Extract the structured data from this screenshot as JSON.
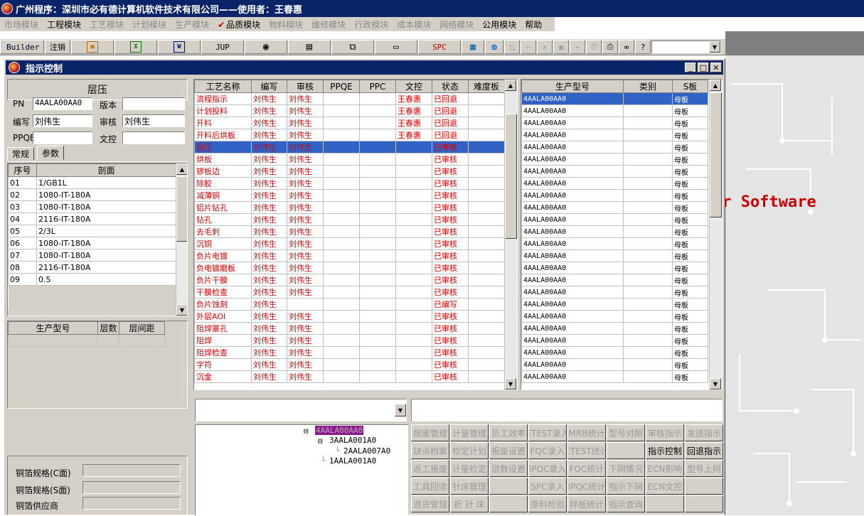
{
  "title": "广州程序：深圳市必有德计算机软件技术有限公司——使用者：王春惠",
  "menus": [
    {
      "label": "市场模块",
      "enabled": false
    },
    {
      "label": "工程模块",
      "enabled": true
    },
    {
      "label": "工艺模块",
      "enabled": false
    },
    {
      "label": "计划模块",
      "enabled": false
    },
    {
      "label": "生产模块",
      "enabled": false
    },
    {
      "label": "品质模块",
      "enabled": true,
      "checked": true
    },
    {
      "label": "物料模块",
      "enabled": false
    },
    {
      "label": "维修模块",
      "enabled": false
    },
    {
      "label": "行政模块",
      "enabled": false
    },
    {
      "label": "成本模块",
      "enabled": false
    },
    {
      "label": "网络模块",
      "enabled": false
    },
    {
      "label": "公用模块",
      "enabled": true
    },
    {
      "label": "帮助",
      "enabled": true
    }
  ],
  "toolbar": {
    "builder": "Builder",
    "logout": "注销",
    "jup": "JUP",
    "spc": "SPC"
  },
  "background_text": "er Software",
  "window": {
    "title": "指示控制"
  },
  "layer": {
    "header": "层压",
    "pn_label": "PN",
    "pn_value": "4AALA00AA0",
    "version_label": "版本",
    "version_value": "",
    "author_label": "编写",
    "author_value": "刘伟生",
    "reviewer_label": "审核",
    "reviewer_value": "刘伟生",
    "ppqe_label": "PPQE",
    "ppqe_value": "",
    "doc_label": "文控",
    "doc_value": "",
    "tabs": [
      "常规",
      "参数"
    ]
  },
  "section_table": {
    "headers": [
      "序号",
      "剖面"
    ],
    "rows": [
      [
        "01",
        "1/GB1L"
      ],
      [
        "02",
        "1080-IT-180A"
      ],
      [
        "03",
        "1080-IT-180A"
      ],
      [
        "04",
        "2116-IT-180A"
      ],
      [
        "05",
        "2/3L"
      ],
      [
        "06",
        "1080-IT-180A"
      ],
      [
        "07",
        "1080-IT-180A"
      ],
      [
        "08",
        "2116-IT-180A"
      ],
      [
        "09",
        "0.5"
      ]
    ]
  },
  "model_table": {
    "headers": [
      "生产型号",
      "层数",
      "层间距"
    ]
  },
  "copper": {
    "c_label": "铜箔规格(C面)",
    "s_label": "铜箔规格(S面)",
    "supplier_label": "铜箔供应商"
  },
  "process_table": {
    "headers": [
      "工艺名称",
      "编写",
      "审核",
      "PPQE",
      "PPC",
      "文控",
      "状态",
      "难度板"
    ],
    "rows": [
      [
        "流程指示",
        "刘伟生",
        "刘伟生",
        "",
        "",
        "王春惠",
        "已回退",
        ""
      ],
      [
        "计划投料",
        "刘伟生",
        "刘伟生",
        "",
        "",
        "王春惠",
        "已回退",
        ""
      ],
      [
        "开料",
        "刘伟生",
        "刘伟生",
        "",
        "",
        "王春惠",
        "已回退",
        ""
      ],
      [
        "开料后烘板",
        "刘伟生",
        "刘伟生",
        "",
        "",
        "王春惠",
        "已回退",
        ""
      ],
      [
        "层压",
        "刘伟生",
        "刘伟生",
        "",
        "",
        "",
        "已审核",
        ""
      ],
      [
        "烘板",
        "刘伟生",
        "刘伟生",
        "",
        "",
        "",
        "已审核",
        ""
      ],
      [
        "锣板边",
        "刘伟生",
        "刘伟生",
        "",
        "",
        "",
        "已审核",
        ""
      ],
      [
        "除胶",
        "刘伟生",
        "刘伟生",
        "",
        "",
        "",
        "已审核",
        ""
      ],
      [
        "减薄铜",
        "刘伟生",
        "刘伟生",
        "",
        "",
        "",
        "已审核",
        ""
      ],
      [
        "铝片钻孔",
        "刘伟生",
        "刘伟生",
        "",
        "",
        "",
        "已审核",
        ""
      ],
      [
        "钻孔",
        "刘伟生",
        "刘伟生",
        "",
        "",
        "",
        "已审核",
        ""
      ],
      [
        "去毛刺",
        "刘伟生",
        "刘伟生",
        "",
        "",
        "",
        "已审核",
        ""
      ],
      [
        "沉铜",
        "刘伟生",
        "刘伟生",
        "",
        "",
        "",
        "已审核",
        ""
      ],
      [
        "负片电镀",
        "刘伟生",
        "刘伟生",
        "",
        "",
        "",
        "已审核",
        ""
      ],
      [
        "负电镀磨板",
        "刘伟生",
        "刘伟生",
        "",
        "",
        "",
        "已审核",
        ""
      ],
      [
        "负片干膜",
        "刘伟生",
        "刘伟生",
        "",
        "",
        "",
        "已审核",
        ""
      ],
      [
        "干膜检查",
        "刘伟生",
        "刘伟生",
        "",
        "",
        "",
        "已审核",
        ""
      ],
      [
        "负片蚀刻",
        "刘伟生",
        "",
        "",
        "",
        "",
        "已编写",
        ""
      ],
      [
        "外层AOI",
        "刘伟生",
        "刘伟生",
        "",
        "",
        "",
        "已审核",
        ""
      ],
      [
        "阻焊塞孔",
        "刘伟生",
        "刘伟生",
        "",
        "",
        "",
        "已审核",
        ""
      ],
      [
        "阻焊",
        "刘伟生",
        "刘伟生",
        "",
        "",
        "",
        "已审核",
        ""
      ],
      [
        "阻焊检查",
        "刘伟生",
        "刘伟生",
        "",
        "",
        "",
        "已审核",
        ""
      ],
      [
        "字符",
        "刘伟生",
        "刘伟生",
        "",
        "",
        "",
        "已审核",
        ""
      ],
      [
        "沉金",
        "刘伟生",
        "刘伟生",
        "",
        "",
        "",
        "已审核",
        ""
      ]
    ],
    "selected_row": 4
  },
  "type_table": {
    "headers": [
      "生产型号",
      "类别",
      "S板"
    ],
    "rows": [
      [
        "4AALA00AA0",
        "",
        "母板"
      ],
      [
        "4AALA00AA0",
        "",
        "母板"
      ],
      [
        "4AALA00AA0",
        "",
        "母板"
      ],
      [
        "4AALA00AA0",
        "",
        "母板"
      ],
      [
        "4AALA00AA0",
        "",
        "母板"
      ],
      [
        "4AALA00AA0",
        "",
        "母板"
      ],
      [
        "4AALA00AA0",
        "",
        "母板"
      ],
      [
        "4AALA00AA0",
        "",
        "母板"
      ],
      [
        "4AALA00AA0",
        "",
        "母板"
      ],
      [
        "4AALA00AA0",
        "",
        "母板"
      ],
      [
        "4AALA00AA0",
        "",
        "母板"
      ],
      [
        "4AALA00AA0",
        "",
        "母板"
      ],
      [
        "4AALA00AA0",
        "",
        "母板"
      ],
      [
        "4AALA00AA0",
        "",
        "母板"
      ],
      [
        "4AALA00AA0",
        "",
        "母板"
      ],
      [
        "4AALA00AA0",
        "",
        "母板"
      ],
      [
        "4AALA00AA0",
        "",
        "母板"
      ],
      [
        "4AALA00AA0",
        "",
        "母板"
      ],
      [
        "4AALA00AA0",
        "",
        "母板"
      ],
      [
        "4AALA00AA0",
        "",
        "母板"
      ],
      [
        "4AALA00AA0",
        "",
        "母板"
      ],
      [
        "4AALA00AA0",
        "",
        "母板"
      ],
      [
        "4AALA00AA0",
        "",
        "母板"
      ],
      [
        "4AALA00AA0",
        "",
        "母板"
      ]
    ]
  },
  "tree": {
    "root": "4AALA00AA0",
    "child": "3AALA001A0",
    "grandchild": "2AALA007A0",
    "sibling": "1AALA001A0"
  },
  "function_buttons": [
    [
      {
        "label": "报废管理",
        "enabled": false
      },
      {
        "label": "计量管理",
        "enabled": false
      },
      {
        "label": "员工效率",
        "enabled": false
      },
      {
        "label": "ETEST录入",
        "enabled": false
      },
      {
        "label": "MRB统计",
        "enabled": false
      },
      {
        "label": "型号对照",
        "enabled": false
      },
      {
        "label": "审核指示",
        "enabled": false
      },
      {
        "label": "发送指示",
        "enabled": false
      }
    ],
    [
      {
        "label": "缺点档案",
        "enabled": false
      },
      {
        "label": "检定计划",
        "enabled": false
      },
      {
        "label": "报废设置",
        "enabled": false
      },
      {
        "label": "FQC录入",
        "enabled": false
      },
      {
        "label": "ETEST统计",
        "enabled": false
      },
      {
        "label": "",
        "enabled": false
      },
      {
        "label": "指示控制",
        "enabled": true
      },
      {
        "label": "回退指示",
        "enabled": true
      }
    ],
    [
      {
        "label": "返工报废",
        "enabled": false
      },
      {
        "label": "计量检定",
        "enabled": false
      },
      {
        "label": "层数设置",
        "enabled": false
      },
      {
        "label": "IPQC录入",
        "enabled": false
      },
      {
        "label": "FQC统计",
        "enabled": false
      },
      {
        "label": "下网情况",
        "enabled": false
      },
      {
        "label": "ECN影响",
        "enabled": false
      },
      {
        "label": "型号上网",
        "enabled": false
      }
    ],
    [
      {
        "label": "工具回收",
        "enabled": false
      },
      {
        "label": "针床管理",
        "enabled": false
      },
      {
        "label": "",
        "enabled": false
      },
      {
        "label": "SPC录入",
        "enabled": false
      },
      {
        "label": "IPQC统计",
        "enabled": false
      },
      {
        "label": "指示下网",
        "enabled": false
      },
      {
        "label": "ECN文控",
        "enabled": false
      },
      {
        "label": "",
        "enabled": false
      }
    ],
    [
      {
        "label": "退货管理",
        "enabled": false
      },
      {
        "label": "折 针 床",
        "enabled": false
      },
      {
        "label": "",
        "enabled": false
      },
      {
        "label": "原料检验",
        "enabled": false
      },
      {
        "label": "样板统计",
        "enabled": false
      },
      {
        "label": "指示查询",
        "enabled": false
      },
      {
        "label": "",
        "enabled": false
      },
      {
        "label": "",
        "enabled": false
      }
    ]
  ],
  "colors": {
    "title_bg": "#0a246a",
    "window_title_bg": "#0a246a",
    "selection": "#3162c6",
    "status_red": "#dd0000"
  }
}
